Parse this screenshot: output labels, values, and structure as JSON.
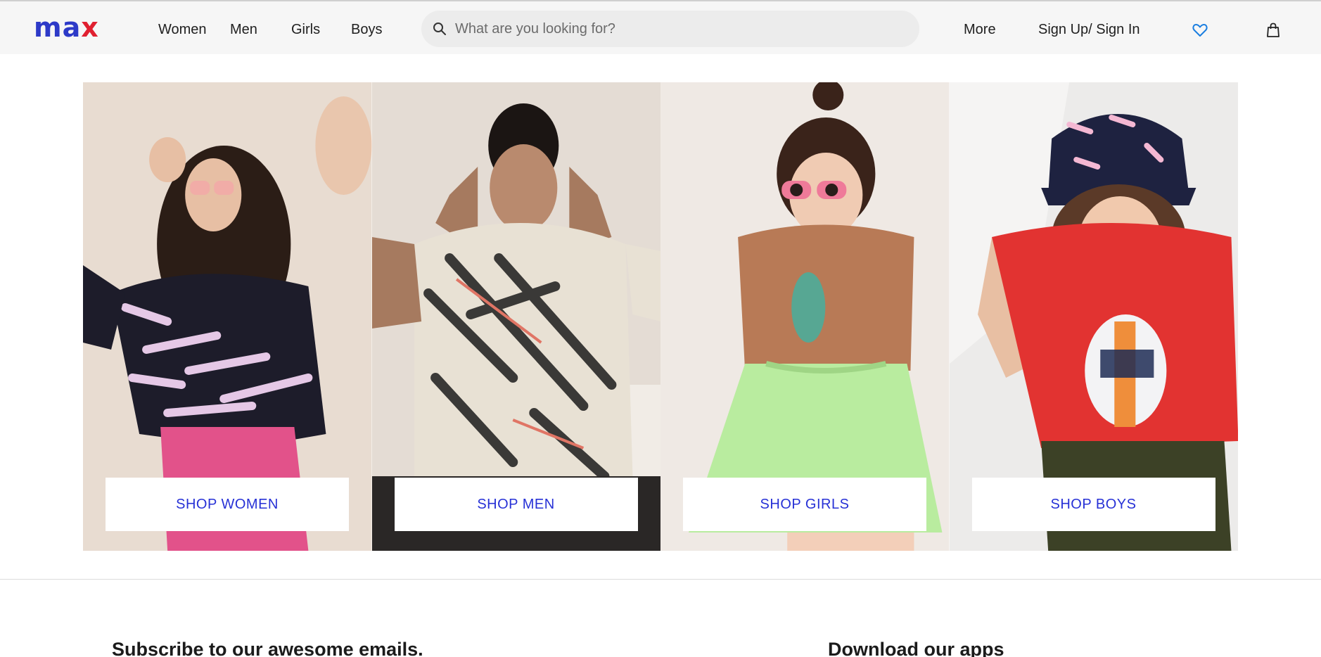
{
  "header": {
    "logo": {
      "letters": [
        "m",
        "a",
        "x"
      ],
      "colors": {
        "primary": "#2d3ac8",
        "accent": "#e02030"
      }
    },
    "nav": [
      {
        "label": "Women"
      },
      {
        "label": "Men"
      },
      {
        "label": "Girls"
      },
      {
        "label": "Boys"
      }
    ],
    "search": {
      "placeholder": "What are you looking for?",
      "value": "",
      "icon": "search-icon"
    },
    "more_label": "More",
    "signin_label": "Sign Up/ Sign In",
    "icons": {
      "wishlist": "heart-icon",
      "cart": "shopping-bag-icon"
    }
  },
  "categories": [
    {
      "button": "SHOP WOMEN",
      "image": "woman-in-printed-shirt-pink-jeans"
    },
    {
      "button": "SHOP MEN",
      "image": "man-in-printed-hoodie-tee"
    },
    {
      "button": "SHOP GIRLS",
      "image": "girl-in-brown-top-green-skirt"
    },
    {
      "button": "SHOP BOYS",
      "image": "boy-in-red-tee-cap"
    }
  ],
  "footer": {
    "subscribe_heading": "Subscribe to our awesome emails.",
    "apps_heading": "Download our apps"
  },
  "colors": {
    "link_blue": "#2731d6",
    "header_bg": "#f6f6f6",
    "wishlist_blue": "#1b7ee0"
  }
}
